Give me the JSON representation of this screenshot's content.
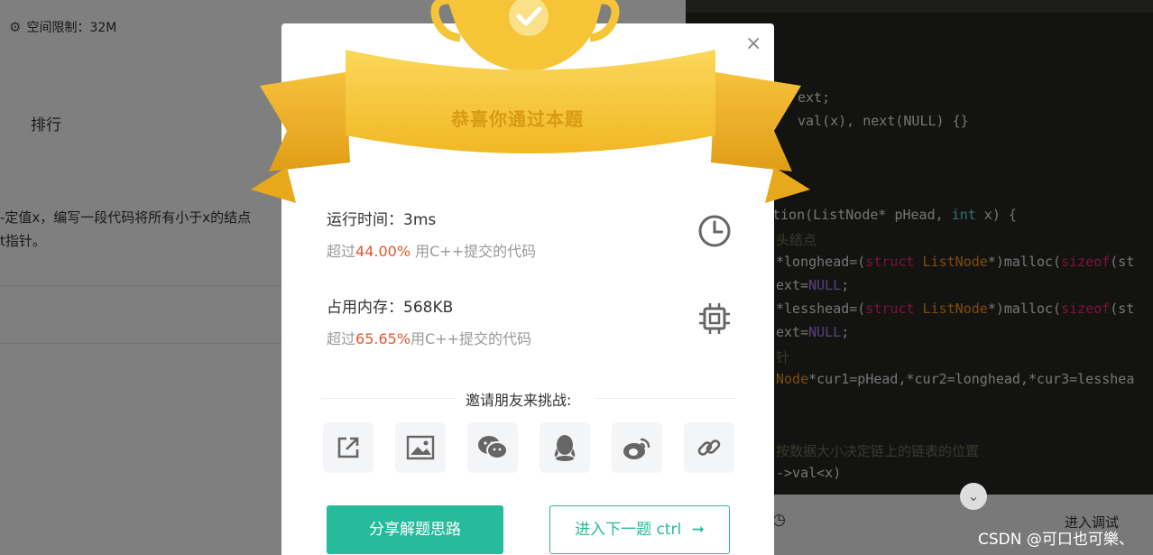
{
  "left_pane": {
    "space_limit": "空间限制：32M",
    "rank_label": "排行",
    "desc_line1": "-定值x，编写一段代码将所有小于x的结点",
    "desc_line2": "t指针。"
  },
  "code": {
    "line_next": "ext;",
    "line_ctor": "val(x), next(NULL) {}",
    "line_func_a": "tion(ListNode* pHead, ",
    "line_func_int": "int",
    "line_func_b": " x) {",
    "line_cm1": "头结点",
    "line_long_a": "*longhead=(",
    "line_struct": "struct",
    "line_listnode": " ListNode",
    "line_long_b": "*)malloc(",
    "line_sizeof": "sizeof",
    "line_long_c": "(st",
    "line_ext1_a": "ext=",
    "line_null": "NULL",
    "line_semi": ";",
    "line_less_a": "*lesshead=(",
    "line_cm2": "针",
    "line_cur_type": "Node",
    "line_cur_b": "*cur1=pHead,*cur2=longhead,*cur3=lesshea",
    "line_cm3": "按数据大小决定链上的链表的位置",
    "line_cond": "->val<x)"
  },
  "footer": {
    "debug": "进入调试",
    "watermark": "CSDN @可口也可樂、"
  },
  "modal": {
    "ribbon_title": "恭喜你通过本题",
    "close": "×",
    "runtime_label": "运行时间：3ms",
    "runtime_prefix": "超过",
    "runtime_pct": "44.00%",
    "runtime_suffix": " 用C++提交的代码",
    "memory_label": "占用内存：568KB",
    "memory_prefix": "超过",
    "memory_pct": "65.65%",
    "memory_suffix": "用C++提交的代码",
    "invite": "邀请朋友来挑战:",
    "share_icons": [
      "share-out-icon",
      "image-icon",
      "wechat-icon",
      "qq-icon",
      "weibo-icon",
      "link-icon"
    ],
    "share_button": "分享解题思路",
    "next_button": "进入下一题 ctrl"
  },
  "colors": {
    "accent": "#25bb9b",
    "highlight": "#e4572e",
    "ribbon": "#f5c030"
  }
}
